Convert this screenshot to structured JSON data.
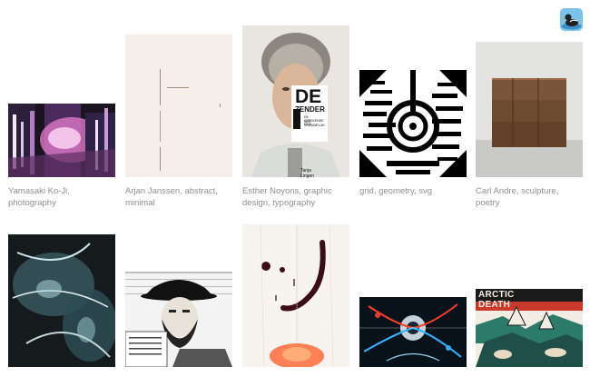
{
  "header": {
    "avatar_icon": "duck-avatar-icon"
  },
  "gallery": [
    {
      "caption": "Yamasaki Ko-Ji, photography"
    },
    {
      "caption": "Arjan Janssen, abstract, minimal"
    },
    {
      "caption": "Esther Noyons, graphic design, typography",
      "poster_title": "DE",
      "poster_subtitle": "ZENDER",
      "poster_small_1": "DE SPREKENDE FILM",
      "poster_small_2": "VAN VROUWELIJK",
      "poster_footer": "Tanja Lingen"
    },
    {
      "caption": "grid, geometry, svg"
    },
    {
      "caption": "Carl Andre, sculpture, poetry"
    },
    {
      "caption": ""
    },
    {
      "caption": ""
    },
    {
      "caption": ""
    },
    {
      "caption": ""
    },
    {
      "caption": "",
      "headline": "ARCTIC DEATH SHIP"
    }
  ]
}
